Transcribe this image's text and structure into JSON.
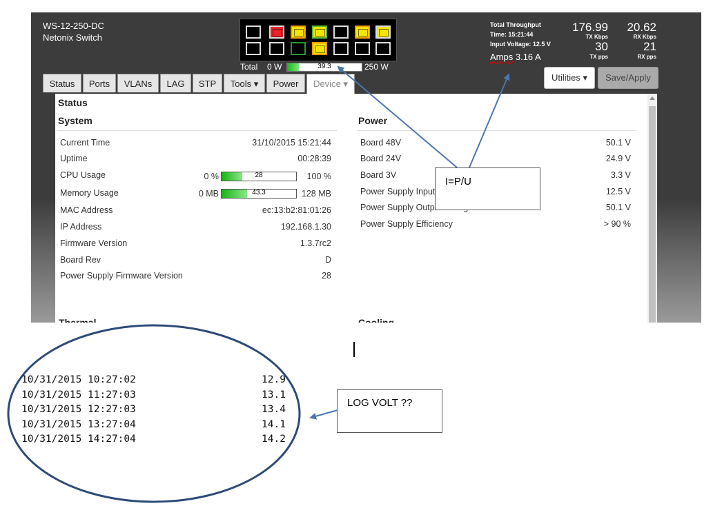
{
  "header": {
    "model": "WS-12-250-DC",
    "product": "Netonix Switch",
    "power": {
      "total_label": "Total",
      "min": "0 W",
      "max": "250 W",
      "value": "39.3",
      "fraction": 0.157
    }
  },
  "ports": {
    "top": [
      "#000000",
      "#e8242a",
      "#f5e300",
      "#f5e300",
      "#000000",
      "#f5e300",
      "#f5e300"
    ],
    "top_border": [
      "#dddddd",
      "#dddddd",
      "#f39800",
      "#58b830",
      "#dddddd",
      "#f39800",
      "#dddddd"
    ],
    "bottom": [
      "#000000",
      "#000000",
      "#000000",
      "#f5e300",
      "#000000",
      "#000000",
      "#000000"
    ],
    "bottom_border": [
      "#dddddd",
      "#dddddd",
      "#1e9a2e",
      "#f39800",
      "#dddddd",
      "#dddddd",
      "#dddddd"
    ]
  },
  "throughput": {
    "title": "Total Throughput",
    "time": "Time: 15:21:44",
    "voltage": "Input Voltage: 12.5 V",
    "amps_label": "Amps",
    "amps_value": "3.16 A",
    "tx_kbps": "176.99",
    "tx_kbps_label": "TX Kbps",
    "rx_kbps": "20.62",
    "rx_kbps_label": "RX Kbps",
    "tx_pps": "30",
    "tx_pps_label": "TX pps",
    "rx_pps": "21",
    "rx_pps_label": "RX pps"
  },
  "buttons": {
    "utilities": "Utilities ▾",
    "save": "Save/Apply"
  },
  "tabs": [
    "Status",
    "Ports",
    "VLANs",
    "LAG",
    "STP",
    "Tools ▾",
    "Power",
    "Device ▾"
  ],
  "status": {
    "heading": "Status",
    "system": {
      "title": "System",
      "rows": [
        {
          "label": "Current Time",
          "value": "31/10/2015 15:21:44"
        },
        {
          "label": "Uptime",
          "value": "00:28:39"
        },
        {
          "label": "CPU Usage",
          "min": "0 %",
          "max": "100 %",
          "bar": "28",
          "fraction": 0.28
        },
        {
          "label": "Memory Usage",
          "min": "0 MB",
          "max": "128 MB",
          "bar": "43.3",
          "fraction": 0.338
        },
        {
          "label": "MAC Address",
          "value": "ec:13:b2:81:01:26"
        },
        {
          "label": "IP Address",
          "value": "192.168.1.30"
        },
        {
          "label": "Firmware Version",
          "value": "1.3.7rc2"
        },
        {
          "label": "Board Rev",
          "value": "D"
        },
        {
          "label": "Power Supply Firmware Version",
          "value": "28"
        }
      ],
      "next_section": "Thermal"
    },
    "power": {
      "title": "Power",
      "rows": [
        {
          "label": "Board 48V",
          "value": "50.1 V"
        },
        {
          "label": "Board 24V",
          "value": "24.9 V"
        },
        {
          "label": "Board 3V",
          "value": "3.3 V"
        },
        {
          "label": "Power Supply Input",
          "value": "12.5 V"
        },
        {
          "label": "Power Supply Output Voltage",
          "value": "50.1 V"
        },
        {
          "label": "Power Supply Efficiency",
          "value": "> 90 %"
        }
      ],
      "next_section": "Cooling"
    }
  },
  "annotations": {
    "formula": "I=P/U",
    "log_note": "LOG VOLT ??"
  },
  "log": [
    {
      "datetime": "10/31/2015 10:27:02",
      "value": "12.9"
    },
    {
      "datetime": "10/31/2015 11:27:03",
      "value": "13.1"
    },
    {
      "datetime": "10/31/2015 12:27:03",
      "value": "13.4"
    },
    {
      "datetime": "10/31/2015 13:27:04",
      "value": "14.1"
    },
    {
      "datetime": "10/31/2015 14:27:04",
      "value": "14.2"
    }
  ]
}
